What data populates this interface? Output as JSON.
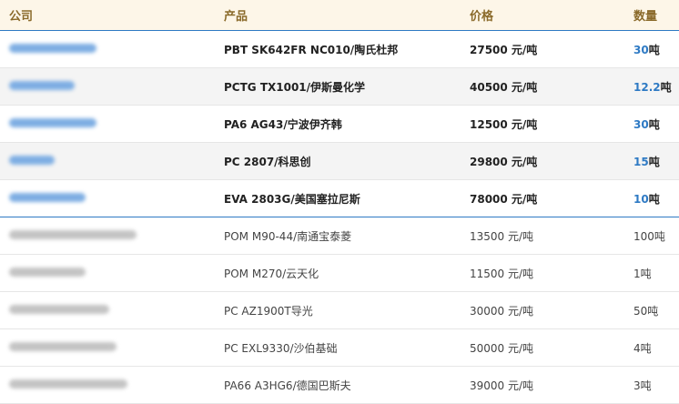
{
  "header": {
    "company": "公司",
    "product": "产品",
    "price": "价格",
    "qty": "数量"
  },
  "top_rows": [
    {
      "company": "上海……塑胶原料",
      "product": "PBT SK642FR NC010/陶氏杜邦",
      "price": "27500 元/吨",
      "qty_num": "30",
      "qty_unit": "吨"
    },
    {
      "company": "……",
      "product": "PCTG TX1001/伊斯曼化学",
      "price": "40500 元/吨",
      "qty_num": "12.2",
      "qty_unit": "吨"
    },
    {
      "company": "……进出口",
      "product": "PA6 AG43/宁波伊齐韩",
      "price": "12500 元/吨",
      "qty_num": "30",
      "qty_unit": "吨"
    },
    {
      "company": "……",
      "product": "PC 2807/科思创",
      "price": "29800 元/吨",
      "qty_num": "15",
      "qty_unit": "吨"
    },
    {
      "company": "……",
      "product": "EVA 2803G/美国塞拉尼斯",
      "price": "78000 元/吨",
      "qty_num": "10",
      "qty_unit": "吨"
    }
  ],
  "rows": [
    {
      "company": "上海……有限公司",
      "product": "POM M90-44/南通宝泰菱",
      "price": "13500 元/吨",
      "qty_num": "100",
      "qty_unit": "吨"
    },
    {
      "company": "……",
      "product": "POM M270/云天化",
      "price": "11500 元/吨",
      "qty_num": "1",
      "qty_unit": "吨"
    },
    {
      "company": "……",
      "product": "PC AZ1900T导光",
      "price": "30000 元/吨",
      "qty_num": "50",
      "qty_unit": "吨"
    },
    {
      "company": "……",
      "product": "PC EXL9330/沙伯基础",
      "price": "50000 元/吨",
      "qty_num": "4",
      "qty_unit": "吨"
    },
    {
      "company": "……",
      "product": "PA66 A3HG6/德国巴斯夫",
      "price": "39000 元/吨",
      "qty_num": "3",
      "qty_unit": "吨"
    }
  ]
}
